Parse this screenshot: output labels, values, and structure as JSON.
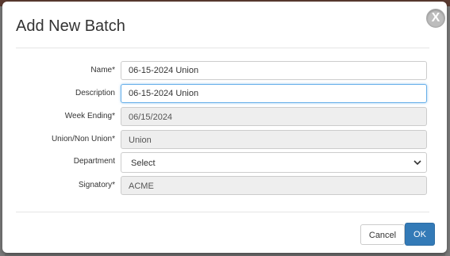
{
  "dialog": {
    "title": "Add New Batch",
    "close_label": "X"
  },
  "form": {
    "name": {
      "label": "Name*",
      "value": "06-15-2024 Union"
    },
    "description": {
      "label": "Description",
      "value": "06-15-2024 Union"
    },
    "week_ending": {
      "label": "Week Ending*",
      "value": "06/15/2024"
    },
    "union": {
      "label": "Union/Non Union*",
      "value": "Union"
    },
    "department": {
      "label": "Department",
      "value": "Select"
    },
    "signatory": {
      "label": "Signatory*",
      "value": "ACME"
    }
  },
  "buttons": {
    "cancel": "Cancel",
    "ok": "OK"
  },
  "colors": {
    "primary": "#337ab7",
    "focus_border": "#66afe9",
    "readonly_bg": "#eeeeee"
  }
}
